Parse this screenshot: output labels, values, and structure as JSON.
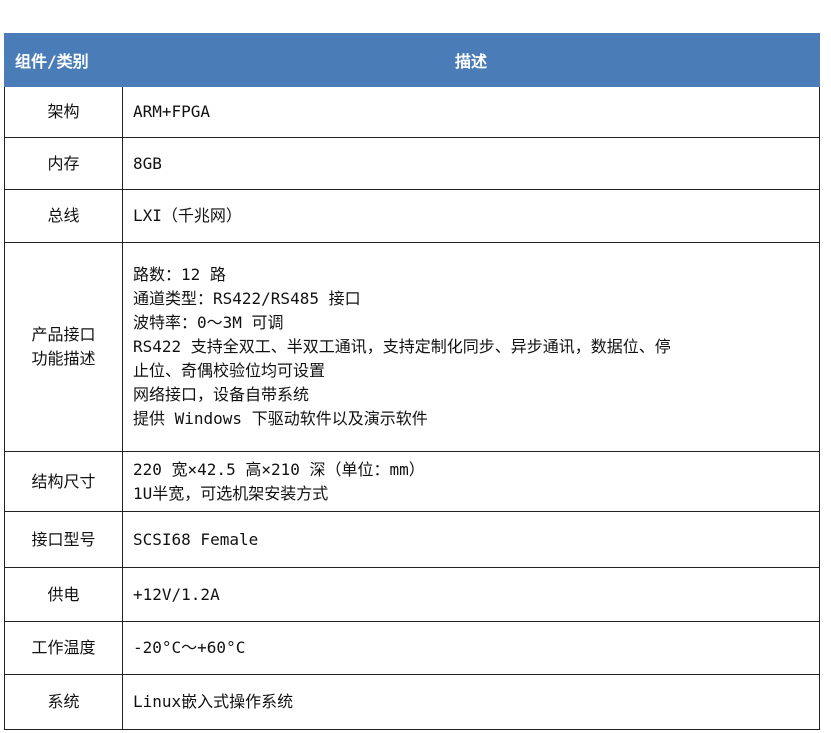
{
  "colors": {
    "header_bg": "#4a7db8",
    "header_text": "#ffffff",
    "border": "#222222"
  },
  "table": {
    "headers": [
      "组件/类别",
      "描述"
    ],
    "rows": [
      {
        "key": "架构",
        "lines": [
          "ARM+FPGA"
        ]
      },
      {
        "key": "内存",
        "lines": [
          "8GB"
        ]
      },
      {
        "key": "总线",
        "lines": [
          "LXI（千兆网）"
        ]
      },
      {
        "key_lines": [
          "产品接口",
          "功能描述"
        ],
        "lines": [
          "路数：12 路",
          "通道类型：RS422/RS485 接口",
          "波特率：0～3M 可调",
          "RS422 支持全双工、半双工通讯，支持定制化同步、异步通讯，数据位、停",
          "止位、奇偶校验位均可设置",
          "网络接口，设备自带系统",
          "提供 Windows 下驱动软件以及演示软件"
        ]
      },
      {
        "key": "结构尺寸",
        "lines": [
          "220 宽×42.5 高×210 深（单位：mm）",
          "1U半宽，可选机架安装方式"
        ]
      },
      {
        "key": "接口型号",
        "lines": [
          "SCSI68 Female"
        ]
      },
      {
        "key": "供电",
        "lines": [
          "+12V/1.2A"
        ]
      },
      {
        "key": "工作温度",
        "lines": [
          "-20°C～+60°C"
        ]
      },
      {
        "key": "系统",
        "lines": [
          "Linux嵌入式操作系统"
        ]
      }
    ]
  }
}
